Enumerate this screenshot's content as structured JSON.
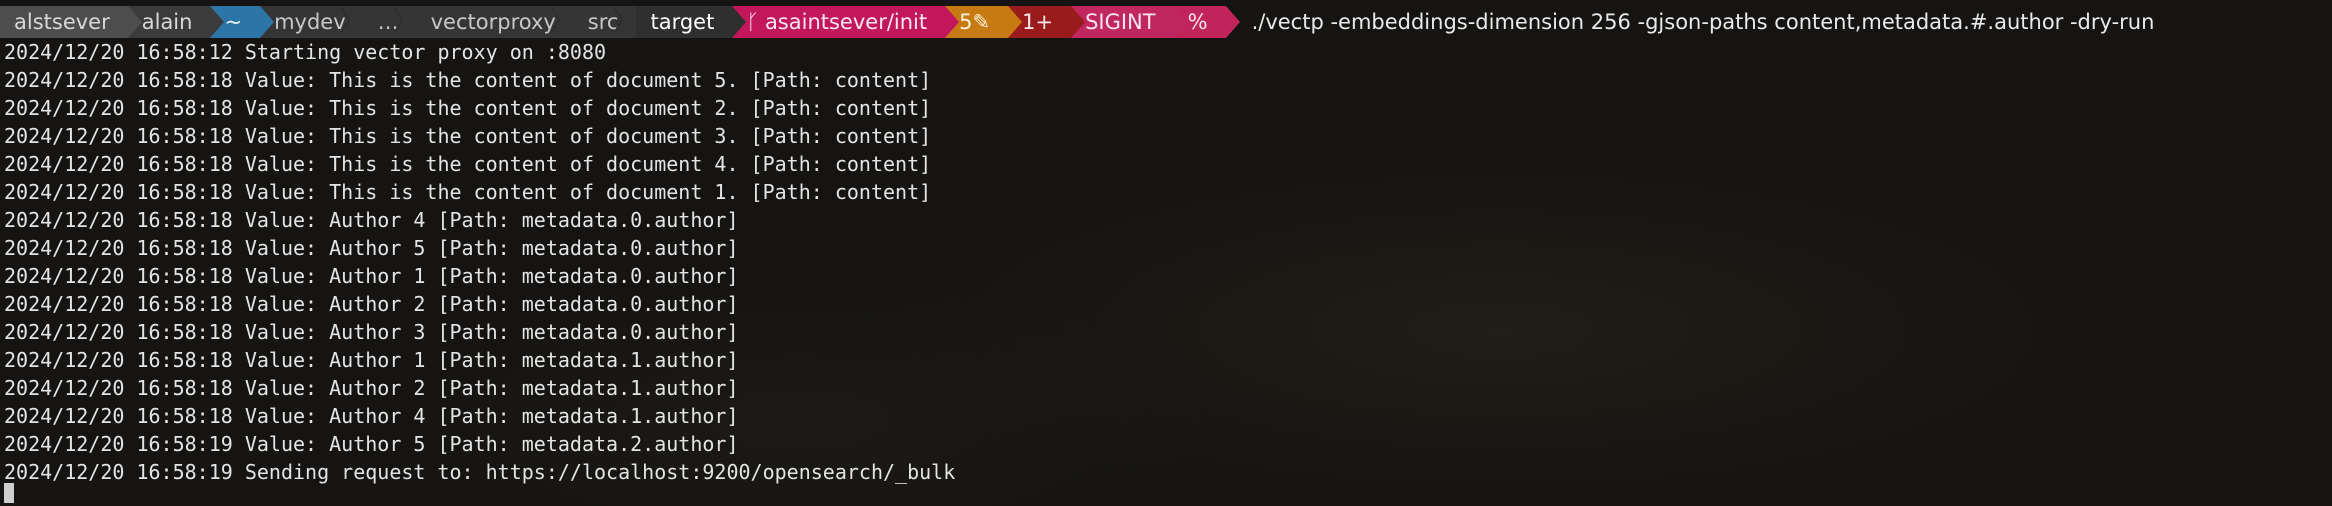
{
  "prompt": {
    "user": "alstsever",
    "host": "alain",
    "home": "~",
    "path": [
      "mydev",
      "…",
      "vectorproxy",
      "src",
      "target"
    ],
    "git_icon": "branch-icon",
    "git_branch": "asaintsever/init",
    "stash": "5✎",
    "jobs": "1+",
    "signal": "SIGINT",
    "symbol": "%",
    "command": "./vectp -embeddings-dimension 256 -gjson-paths content,metadata.#.author -dry-run"
  },
  "output": [
    "2024/12/20 16:58:12 Starting vector proxy on :8080",
    "2024/12/20 16:58:18 Value: This is the content of document 5. [Path: content]",
    "2024/12/20 16:58:18 Value: This is the content of document 2. [Path: content]",
    "2024/12/20 16:58:18 Value: This is the content of document 3. [Path: content]",
    "2024/12/20 16:58:18 Value: This is the content of document 4. [Path: content]",
    "2024/12/20 16:58:18 Value: This is the content of document 1. [Path: content]",
    "2024/12/20 16:58:18 Value: Author 4 [Path: metadata.0.author]",
    "2024/12/20 16:58:18 Value: Author 5 [Path: metadata.0.author]",
    "2024/12/20 16:58:18 Value: Author 1 [Path: metadata.0.author]",
    "2024/12/20 16:58:18 Value: Author 2 [Path: metadata.0.author]",
    "2024/12/20 16:58:18 Value: Author 3 [Path: metadata.0.author]",
    "2024/12/20 16:58:18 Value: Author 1 [Path: metadata.1.author]",
    "2024/12/20 16:58:18 Value: Author 2 [Path: metadata.1.author]",
    "2024/12/20 16:58:18 Value: Author 4 [Path: metadata.1.author]",
    "2024/12/20 16:58:19 Value: Author 5 [Path: metadata.2.author]",
    "2024/12/20 16:58:19 Sending request to: https://localhost:9200/opensearch/_bulk"
  ],
  "colors": {
    "background": "#151412",
    "home_segment": "#2b76a6",
    "git_segment": "#c2185b",
    "stash_segment": "#c87a12",
    "jobs_segment": "#9a1b1b"
  }
}
